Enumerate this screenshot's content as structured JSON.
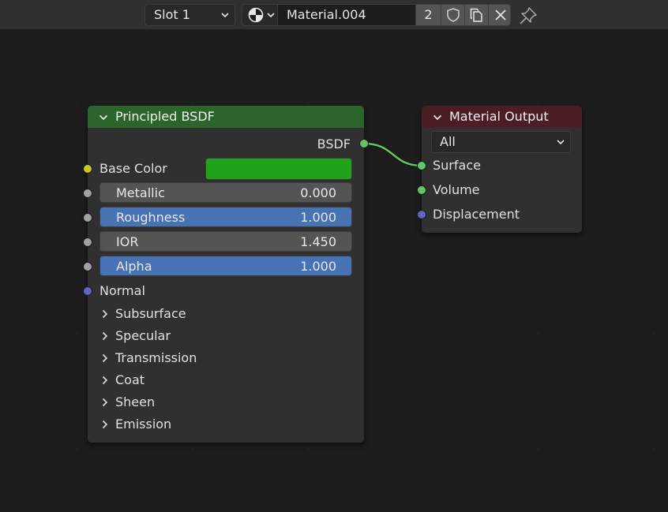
{
  "header": {
    "slot": "Slot 1",
    "material_name": "Material.004",
    "user_count": "2"
  },
  "principled": {
    "title": "Principled BSDF",
    "output_label": "BSDF",
    "base_color_label": "Base Color",
    "base_color": "#21a21b",
    "metallic": {
      "label": "Metallic",
      "value": "0.000"
    },
    "roughness": {
      "label": "Roughness",
      "value": "1.000"
    },
    "ior": {
      "label": "IOR",
      "value": "1.450"
    },
    "alpha": {
      "label": "Alpha",
      "value": "1.000"
    },
    "normal_label": "Normal",
    "panels": [
      "Subsurface",
      "Specular",
      "Transmission",
      "Coat",
      "Sheen",
      "Emission"
    ]
  },
  "output_node": {
    "title": "Material Output",
    "target": "All",
    "inputs": [
      "Surface",
      "Volume",
      "Displacement"
    ]
  },
  "colors": {
    "shader_header": "#2b652b",
    "output_header": "#4d1d26",
    "shader_socket": "#62c762",
    "vector_socket": "#6363c7",
    "color_socket": "#c7c729",
    "float_socket": "#a1a1a1",
    "slider_fill": "#4772b3"
  }
}
